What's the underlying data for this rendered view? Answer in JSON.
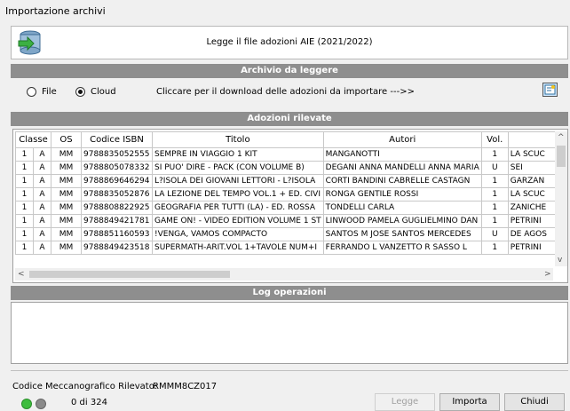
{
  "window": {
    "title": "Importazione archivi"
  },
  "header": {
    "text": "Legge il file adozioni AIE (2021/2022)",
    "icon": "database-import-icon"
  },
  "archivio": {
    "band": "Archivio da leggere",
    "options": [
      "File",
      "Cloud"
    ],
    "selected": "Cloud",
    "download_text": "Cliccare per il download delle adozioni da importare --->>",
    "download_icon": "download-icon"
  },
  "adozioni": {
    "band": "Adozioni rilevate",
    "columns": [
      "Classe",
      "",
      "OS",
      "Codice ISBN",
      "Titolo",
      "Autori",
      "Vol.",
      ""
    ],
    "rows": [
      [
        "1",
        "A",
        "MM",
        "9788835052555",
        "SEMPRE IN VIAGGIO 1 KIT",
        "MANGANOTTI",
        "1",
        "LA SCUC"
      ],
      [
        "1",
        "A",
        "MM",
        "9788805078332",
        "SI PUO' DIRE - PACK (CON VOLUME B)",
        "DEGANI ANNA MANDELLI ANNA MARIA",
        "U",
        "SEI"
      ],
      [
        "1",
        "A",
        "MM",
        "9788869646294",
        "L?ISOLA DEI GIOVANI LETTORI - L?ISOLA",
        "CORTI  BANDINI  CABRELLE CASTAGN",
        "1",
        "GARZAN"
      ],
      [
        "1",
        "A",
        "MM",
        "9788835052876",
        "LA LEZIONE DEL TEMPO VOL.1 + ED. CIVI",
        "RONGA GENTILE ROSSI",
        "1",
        "LA SCUC"
      ],
      [
        "1",
        "A",
        "MM",
        "9788808822925",
        "GEOGRAFIA PER TUTTI (LA) - ED. ROSSA",
        "TONDELLI CARLA",
        "1",
        "ZANICHE"
      ],
      [
        "1",
        "A",
        "MM",
        "9788849421781",
        "GAME ON! - VIDEO EDITION VOLUME 1 ST",
        "LINWOOD PAMELA GUGLIELMINO DAN",
        "1",
        "PETRINI"
      ],
      [
        "1",
        "A",
        "MM",
        "9788851160593",
        "!VENGA, VAMOS COMPACTO",
        "SANTOS M JOSE  SANTOS MERCEDES",
        "U",
        "DE AGOS"
      ],
      [
        "1",
        "A",
        "MM",
        "9788849423518",
        "SUPERMATH-ARIT.VOL 1+TAVOLE NUM+I",
        "FERRANDO L VANZETTO R SASSO L",
        "1",
        "PETRINI"
      ]
    ]
  },
  "log": {
    "band": "Log operazioni"
  },
  "footer": {
    "codice_label": "Codice Meccanografico Rilevato:",
    "codice_value": "RMMM8CZ017",
    "counter": "0 di 324",
    "status_colors": {
      "green": "#3ebd3e",
      "gray": "#8a8a8a"
    }
  },
  "buttons": {
    "legge": "Legge",
    "importa": "Importa",
    "chiudi": "Chiudi"
  }
}
